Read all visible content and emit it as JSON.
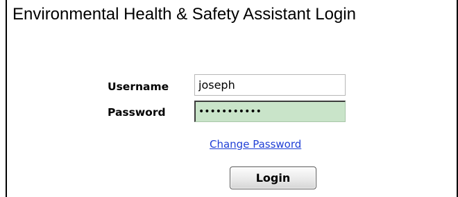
{
  "page": {
    "title": "Environmental Health & Safety Assistant Login"
  },
  "form": {
    "username_label": "Username",
    "username_value": "joseph",
    "password_label": "Password",
    "password_value": "joseph12345",
    "change_password_link": "Change Password",
    "login_button": "Login"
  },
  "colors": {
    "password_field_bg": "#c9e4c9",
    "link": "#1f3fd6",
    "frame_border": "#000000"
  }
}
